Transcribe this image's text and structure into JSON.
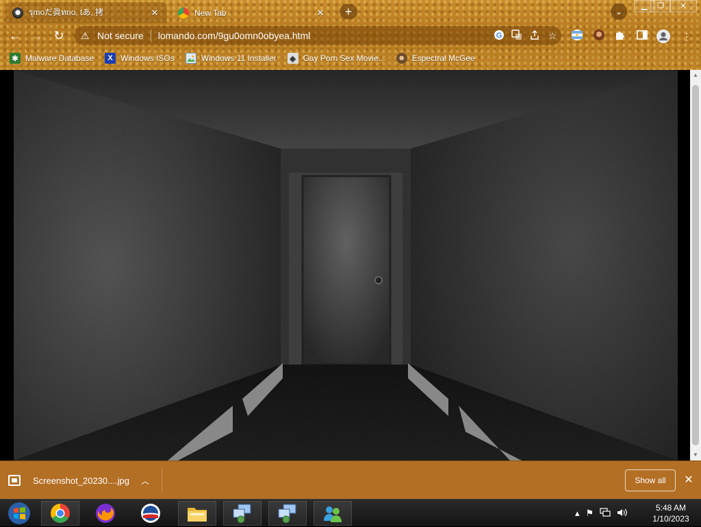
{
  "browser": {
    "tabs": [
      {
        "title": "รุmoだ眞ทno, tあ, 拷",
        "active": true
      },
      {
        "title": "New Tab",
        "active": false
      }
    ],
    "new_tab_symbol": "+",
    "tab_search_symbol": "⌄",
    "window_controls": {
      "minimize": "▁",
      "restore": "❐",
      "close": "✕"
    },
    "nav": {
      "back": "←",
      "forward": "→",
      "reload": "↻"
    },
    "omnibox": {
      "security_label": "Not secure",
      "url": "lomando.com/9gu0omn0obyea.html"
    },
    "bookmarks": [
      {
        "label": "Malware Database",
        "icon": "bug-icon",
        "color": "#2e7d32"
      },
      {
        "label": "Windows ISOs",
        "icon": "x-logo-icon",
        "color": "#1a3fb5"
      },
      {
        "label": "Windows 11 Installer",
        "icon": "image-icon",
        "color": "#4caf50"
      },
      {
        "label": "Gay Porn Sex Movie...",
        "icon": "site-icon",
        "color": "#555555"
      },
      {
        "label": "Espectral McGee",
        "icon": "face-icon",
        "color": "#6d4c2a"
      }
    ]
  },
  "download_shelf": {
    "file_name": "Screenshot_20230....jpg",
    "show_all_label": "Show all"
  },
  "taskbar": {
    "apps": [
      "windows-start-icon",
      "chrome-icon",
      "firefox-icon",
      "obama-logo-icon",
      "file-explorer-icon",
      "network-computer-icon",
      "network-computer-icon",
      "messenger-icon"
    ],
    "time": "5:48 AM",
    "date": "1/10/2023"
  },
  "colors": {
    "chrome_accent": "#b5781f",
    "shelf": "#b36f24",
    "taskbar": "#1c1c1c"
  }
}
